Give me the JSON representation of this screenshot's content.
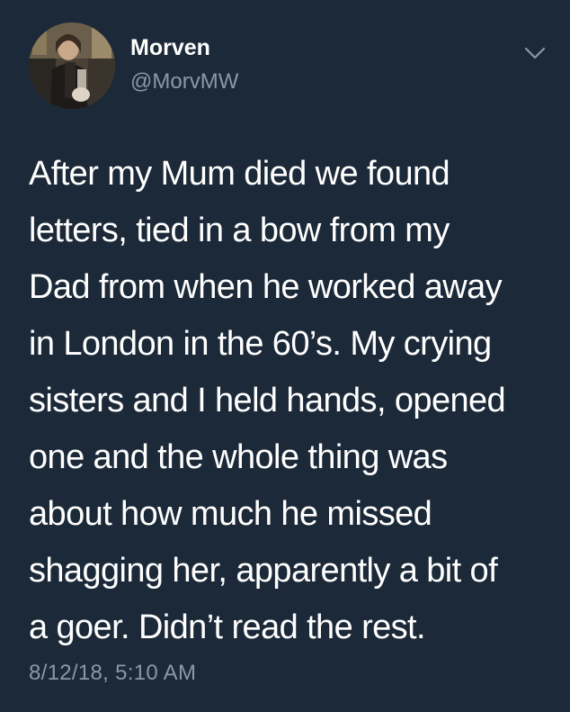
{
  "user": {
    "display_name": "Morven",
    "handle": "@MorvMW"
  },
  "tweet": {
    "lines": [
      "After my Mum died we found",
      "letters, tied in a bow from my",
      "Dad from when he worked away",
      "in London in the 60’s. My crying",
      "sisters and I held hands, opened",
      "one and the whole thing was",
      "about how much he missed",
      "shagging her, apparently a bit of",
      "a goer. Didn’t read the rest."
    ],
    "timestamp": "8/12/18, 5:10 AM"
  },
  "icons": {
    "menu": "chevron-down-icon",
    "avatar": "profile-photo"
  },
  "colors": {
    "background": "#1c2938",
    "text": "#ffffff",
    "secondary_text": "#8899a6"
  }
}
